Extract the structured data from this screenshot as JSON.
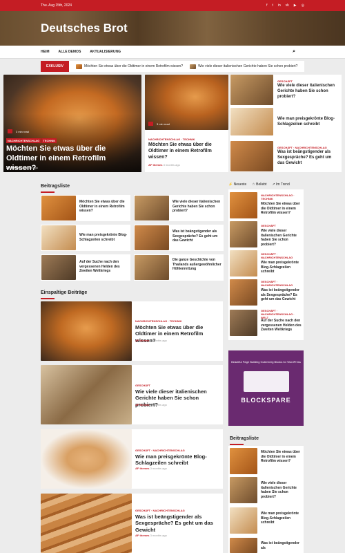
{
  "topbar": {
    "date": "Thu. Aug 15th, 2024",
    "social_icons": [
      "facebook-icon",
      "twitter-icon",
      "linkedin-icon",
      "vk-icon",
      "youtube-icon",
      "instagram-icon"
    ]
  },
  "site": {
    "title": "Deutsches Brot"
  },
  "nav": {
    "items": [
      "HEIM",
      "ALLE DEMOS",
      "AKTUALISIERUNG"
    ]
  },
  "ticker": {
    "label": "EXKLUSIV",
    "items": [
      "Möchten Sie etwas über die Oldtimer in einem Retrofilm wissen?",
      "Wie viele dieser italienischen Gerichte haben Sie schon probiert?"
    ]
  },
  "featured": {
    "main": {
      "readtime": "3 min read",
      "categories": [
        "NACHRICHTENSCHLAG",
        "TECHNIK"
      ],
      "title": "Möchten Sie etwas über die Oldtimer in einem Retrofilm wissen?",
      "author": "AF themes",
      "date": "3 months ago"
    },
    "second": {
      "readtime": "3 min read",
      "categories": "NACHRICHTENSCHLAG · TECHNIK",
      "title": "Möchten Sie etwas über die Oldtimer in einem Retrofilm wissen?",
      "author": "AF themes",
      "date": "3 months ago"
    },
    "side": [
      {
        "cat": "GESCHÄFT",
        "title": "Wie viele dieser italienischen Gerichte haben Sie schon probiert?"
      },
      {
        "cat": "",
        "title": "Wie man preisgekrönte Blog-Schlagzeilen schreibt"
      },
      {
        "cat": "GESCHÄFT · NACHRICHTENSCHLAG",
        "title": "Was ist beängstigender als Sexgespräche? Es geht um das Gewicht"
      }
    ]
  },
  "beitragsliste": {
    "heading": "Beitragsliste",
    "items": [
      "Möchten Sie etwas über die Oldtimer in einem Retrofilm wissen?",
      "Wie viele dieser italienischen Gerichte haben Sie schon probiert?",
      "Wie man preisgekrönte Blog-Schlagzeilen schreibt",
      "Was ist beängstigender als Sexgespräche? Es geht um das Gewicht",
      "Auf der Suche nach den vergessenen Helden des Zweiten Weltkriegs",
      "Die ganze Geschichte von Thailands außergewöhnlicher Höhlenrettung"
    ]
  },
  "single": {
    "heading": "Einspaltige Beiträge",
    "posts": [
      {
        "cat": "NACHRICHTENSCHLAG · TECHNIK",
        "title": "Möchten Sie etwas über die Oldtimer in einem Retrofilm wissen?",
        "author": "AF themes",
        "date": "3 months ago"
      },
      {
        "cat": "GESCHÄFT",
        "title": "Wie viele dieser italienischen Gerichte haben Sie schon probiert?",
        "author": "AF themes",
        "date": "3 months ago"
      },
      {
        "cat": "GESCHÄFT · NACHRICHTENSCHLAG",
        "title": "Wie man preisgekrönte Blog-Schlagzeilen schreibt",
        "author": "AF themes",
        "date": "3 months ago"
      },
      {
        "cat": "GESCHÄFT · NACHRICHTENSCHLAG",
        "title": "Was ist beängstigender als Sexgespräche? Es geht um das Gewicht",
        "author": "AF themes",
        "date": "3 months ago"
      }
    ]
  },
  "sidebar": {
    "tabs": [
      "Neueste",
      "Beliebt",
      "Im Trend"
    ],
    "tab_posts": [
      {
        "cat": "NACHRICHTENSCHLAG · TECHNIK",
        "title": "Möchten Sie etwas über die Oldtimer in einem Retrofilm wissen?"
      },
      {
        "cat": "GESCHÄFT",
        "title": "Wie viele dieser italienischen Gerichte haben Sie schon probiert?"
      },
      {
        "cat": "GESCHÄFT · NACHRICHTENSCHLAG",
        "title": "Wie man preisgekrönte Blog-Schlagzeilen schreibt"
      },
      {
        "cat": "GESCHÄFT · NACHRICHTENSCHLAG",
        "title": "Was ist beängstigender als Sexgespräche? Es geht um das Gewicht"
      },
      {
        "cat": "GESCHÄFT · NACHRICHTENSCHLAG · WELT",
        "title": "Auf der Suche nach den vergessenen Helden des Zweiten Weltkriegs"
      }
    ],
    "ad": {
      "line": "Beautiful Page Building Gutenberg Blocks for WordPress",
      "brand": "BLOCKSPARE"
    },
    "list_heading": "Beitragsliste",
    "list": [
      "Möchten Sie etwas über die Oldtimer in einem Retrofilm wissen?",
      "Wie viele dieser italienischen Gerichte haben Sie schon probiert?",
      "Wie man preisgekrönte Blog-Schlagzeilen schreibt",
      "Was ist beängstigender als"
    ]
  }
}
